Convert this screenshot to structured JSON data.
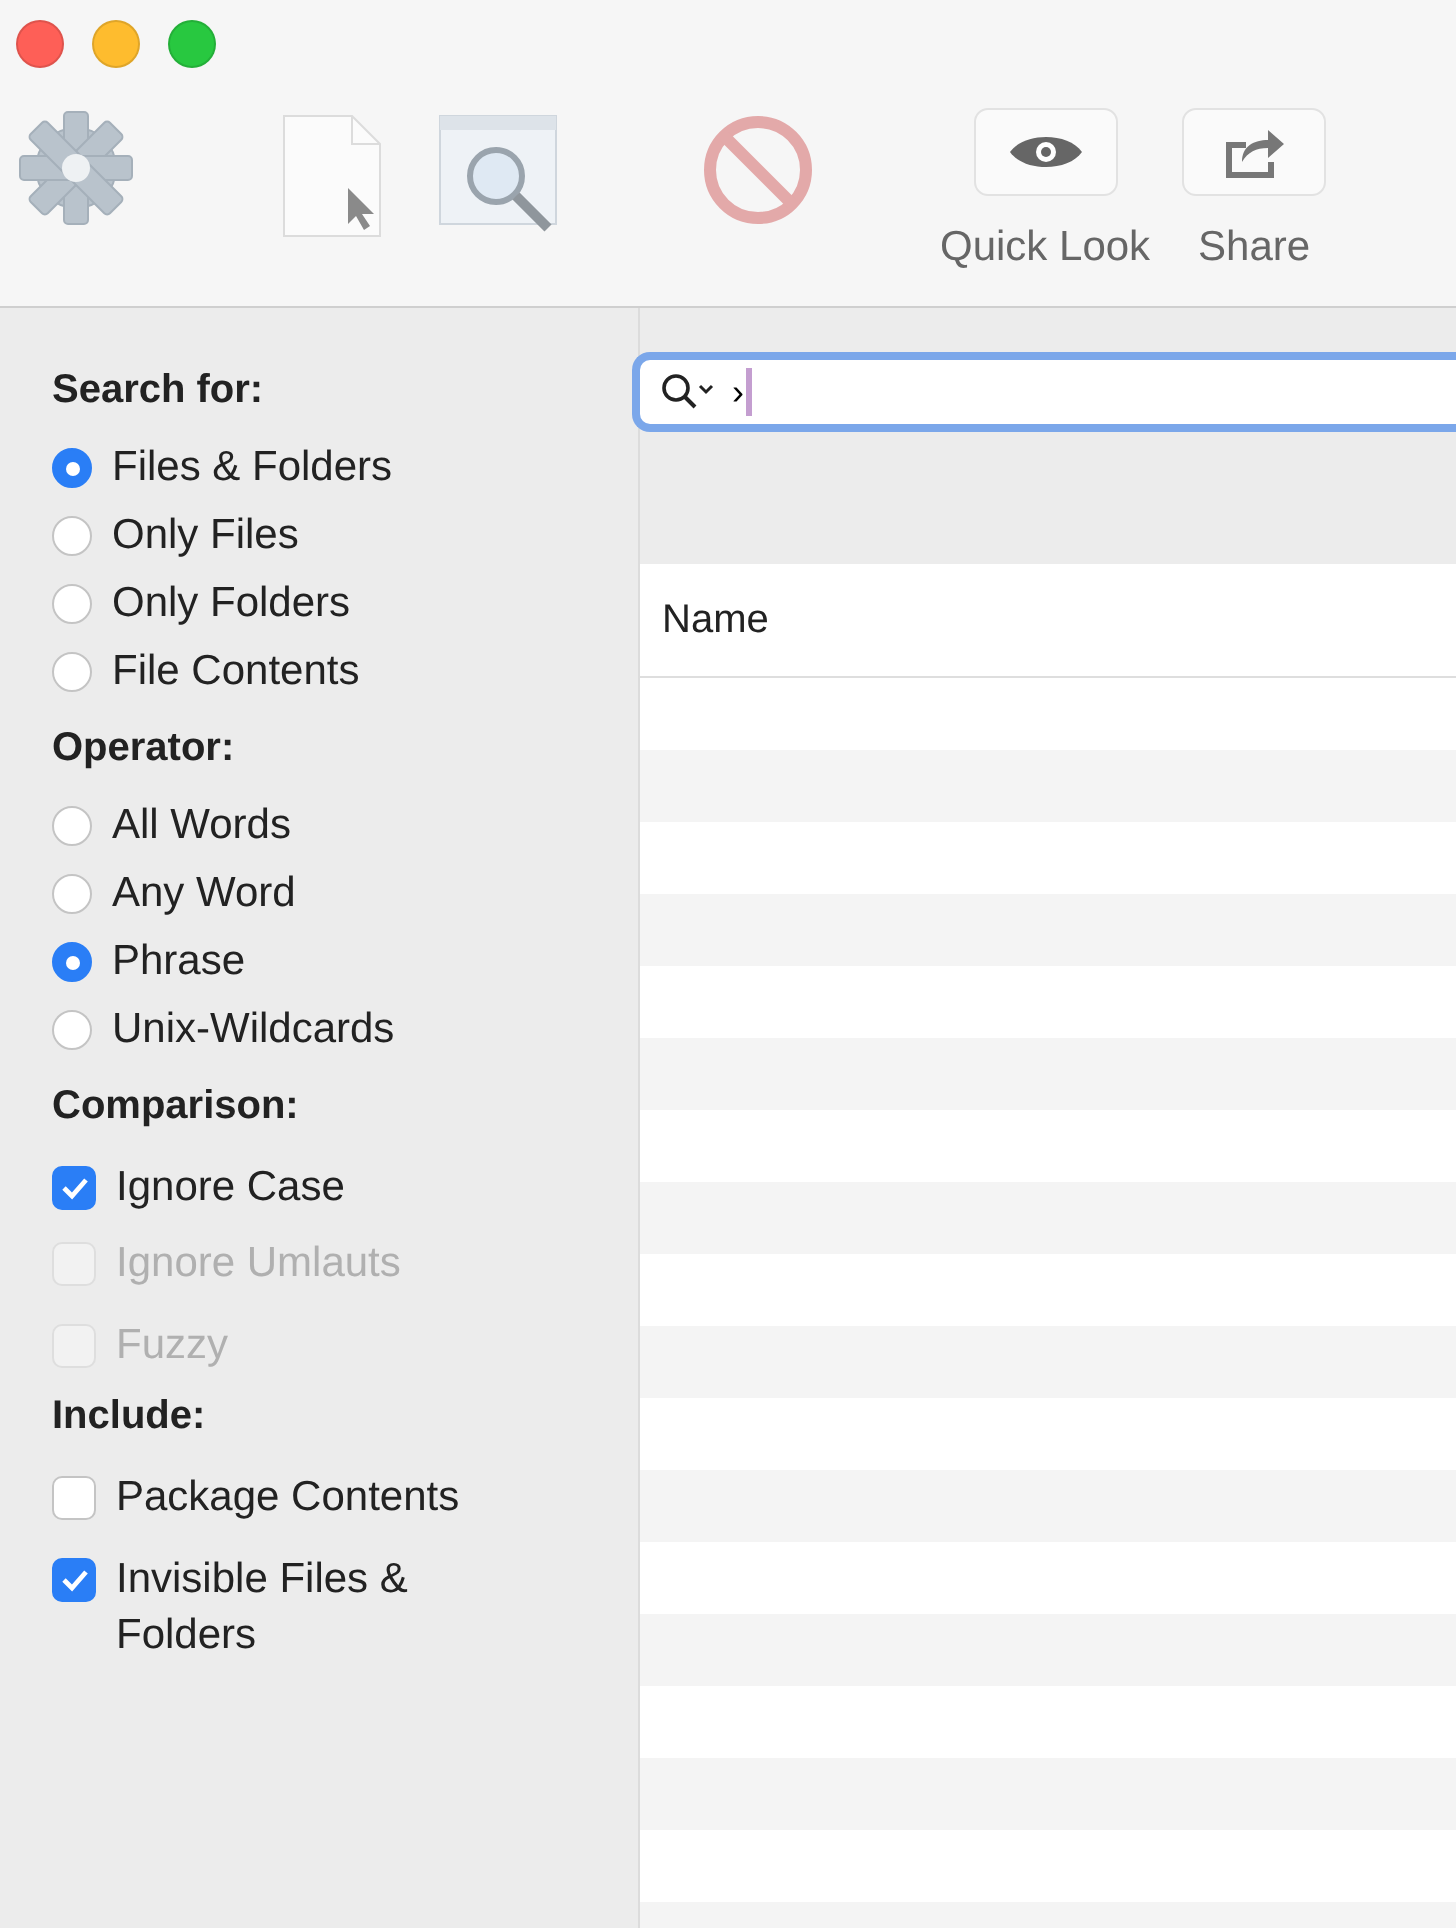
{
  "window": {
    "controls": [
      {
        "kind": "close"
      },
      {
        "kind": "minimize"
      },
      {
        "kind": "zoom"
      }
    ]
  },
  "toolbar": {
    "items": [
      {
        "kind": "gear"
      },
      {
        "kind": "document"
      },
      {
        "kind": "preview"
      },
      {
        "kind": "stop"
      }
    ],
    "buttons": [
      {
        "kind": "eye",
        "label": "Quick Look"
      },
      {
        "kind": "share",
        "label": "Share"
      }
    ]
  },
  "sidebar": {
    "sections": [
      {
        "title": "Search for:",
        "kind": "radio",
        "options": [
          {
            "label": "Files & Folders",
            "selected": true
          },
          {
            "label": "Only Files",
            "selected": false
          },
          {
            "label": "Only Folders",
            "selected": false
          },
          {
            "label": "File Contents",
            "selected": false
          }
        ]
      },
      {
        "title": "Operator:",
        "kind": "radio",
        "options": [
          {
            "label": "All Words",
            "selected": false
          },
          {
            "label": "Any Word",
            "selected": false
          },
          {
            "label": "Phrase",
            "selected": true
          },
          {
            "label": "Unix-Wildcards",
            "selected": false
          }
        ]
      },
      {
        "title": "Comparison:",
        "kind": "checkbox",
        "options": [
          {
            "label": "Ignore Case",
            "checked": true,
            "disabled": false
          },
          {
            "label": "Ignore Umlauts",
            "checked": false,
            "disabled": true
          },
          {
            "label": "Fuzzy",
            "checked": false,
            "disabled": true
          }
        ]
      },
      {
        "title": "Include:",
        "kind": "checkbox",
        "options": [
          {
            "label": "Package Contents",
            "checked": false,
            "disabled": false
          },
          {
            "label": "Invisible Files & Folders",
            "checked": true,
            "disabled": false
          }
        ]
      }
    ]
  },
  "search": {
    "value": "›"
  },
  "table": {
    "columns": [
      "Name"
    ]
  }
}
